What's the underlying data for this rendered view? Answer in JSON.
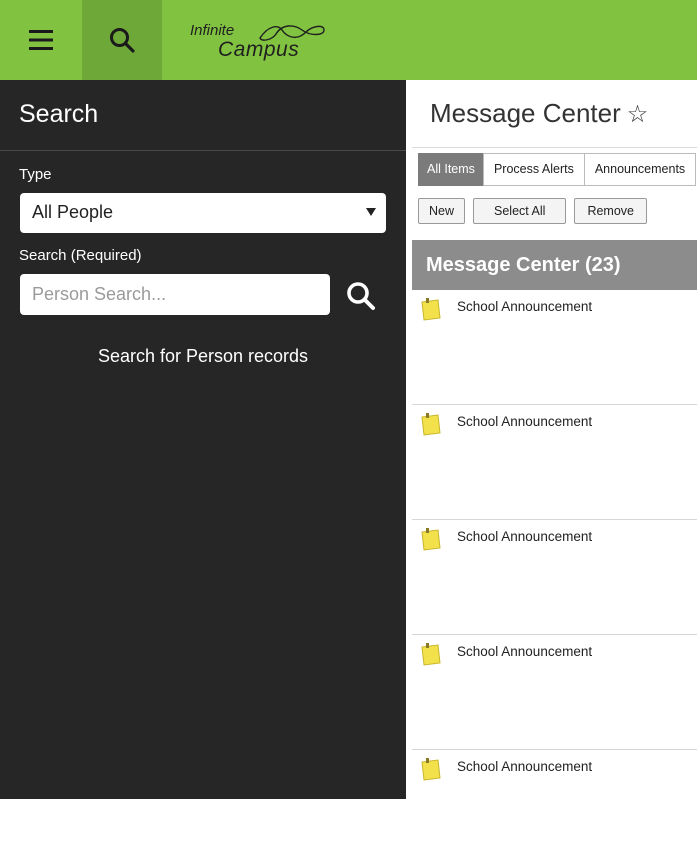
{
  "topbar": {
    "logo_line1": "Infinite",
    "logo_line2": "Campus",
    "menu_icon": "hamburger-icon",
    "search_icon": "search-icon"
  },
  "sidebar": {
    "title": "Search",
    "type_label": "Type",
    "type_value": "All People",
    "search_label": "Search (Required)",
    "search_placeholder": "Person Search...",
    "hint": "Search for Person records"
  },
  "main": {
    "title": "Message Center",
    "star": "☆",
    "tabs": [
      {
        "label": "All Items",
        "active": true
      },
      {
        "label": "Process Alerts",
        "active": false
      },
      {
        "label": "Announcements",
        "active": false
      }
    ],
    "actions": [
      "New",
      "Select All",
      "Remove"
    ],
    "list_header": "Message Center (23)",
    "messages": [
      {
        "subject": "School Announcement"
      },
      {
        "subject": "School Announcement"
      },
      {
        "subject": "School Announcement"
      },
      {
        "subject": "School Announcement"
      },
      {
        "subject": "School Announcement"
      }
    ]
  },
  "colors": {
    "brand_green": "#81c341",
    "sidebar_bg": "#262626",
    "header_gray": "#8c8c8c"
  }
}
